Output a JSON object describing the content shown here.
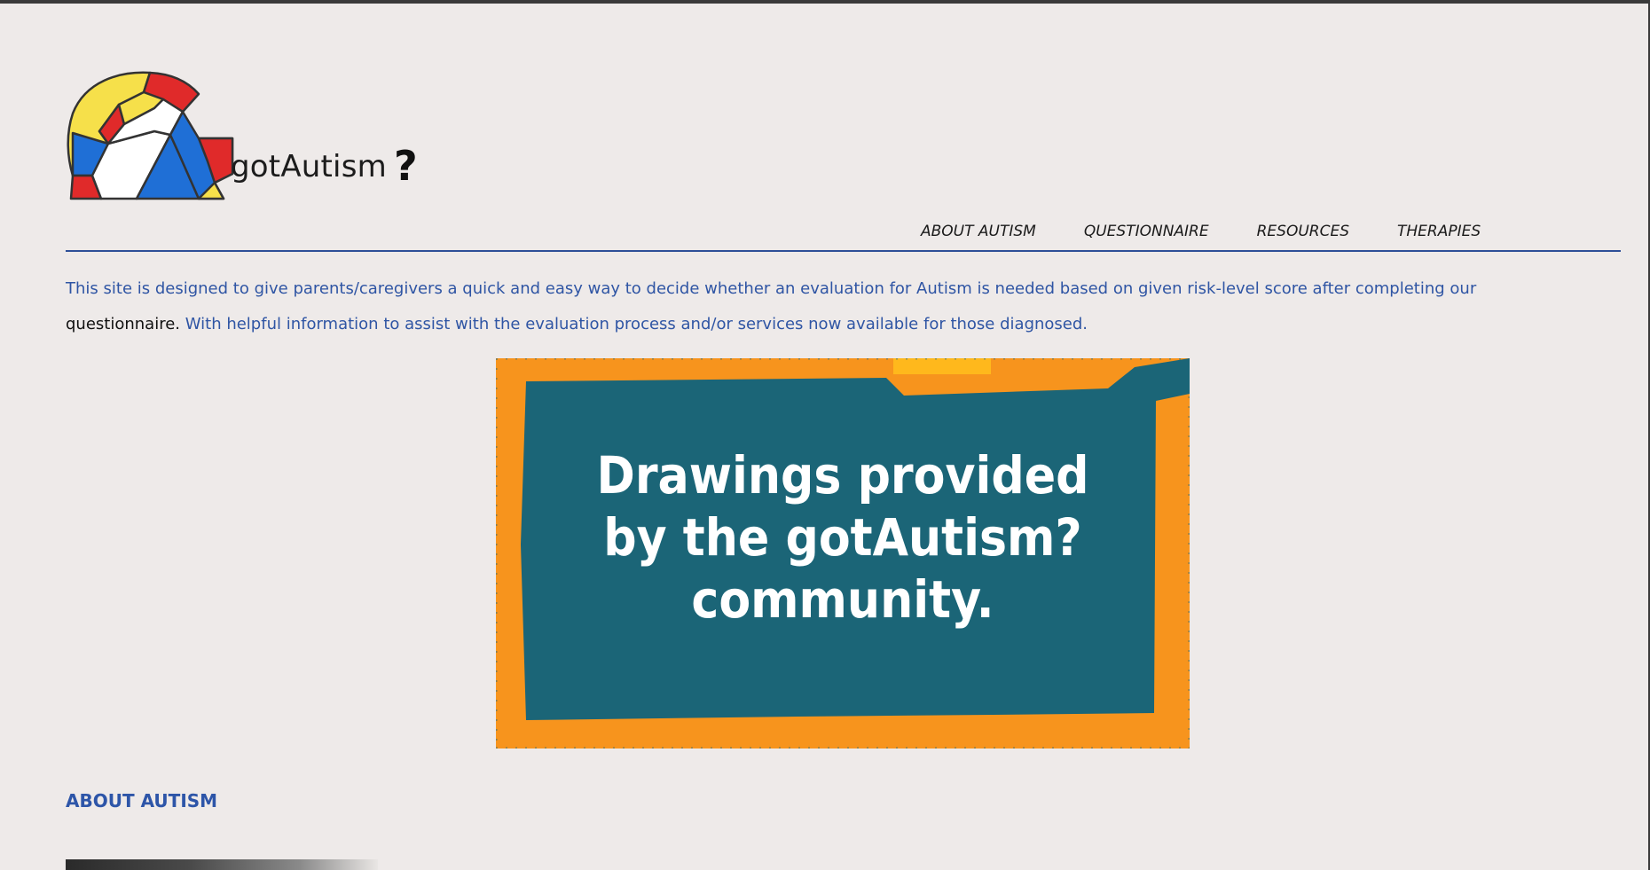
{
  "brand": {
    "name": "gotAutism",
    "question_mark": "?"
  },
  "nav": {
    "items": [
      {
        "label": "ABOUT AUTISM"
      },
      {
        "label": "QUESTIONNAIRE"
      },
      {
        "label": "RESOURCES"
      },
      {
        "label": "THERAPIES"
      }
    ]
  },
  "intro": {
    "part1": "This site is designed to give parents/caregivers a quick and easy way to decide whether an evaluation for Autism is needed based on given risk-level score after completing our ",
    "link": "questionnaire.",
    "part2": " With helpful information to assist with the evaluation process and/or services now available for those diagnosed."
  },
  "banner": {
    "line1": "Drawings provided",
    "line2": "by the gotAutism?",
    "line3": "community.",
    "colors": {
      "frame": "#f7941d",
      "panel": "#1b6577",
      "text": "#ffffff"
    }
  },
  "section": {
    "title": "ABOUT AUTISM"
  },
  "colors": {
    "background": "#eeeae9",
    "accent": "#2d4f98",
    "text_blue": "#2f55a4"
  }
}
